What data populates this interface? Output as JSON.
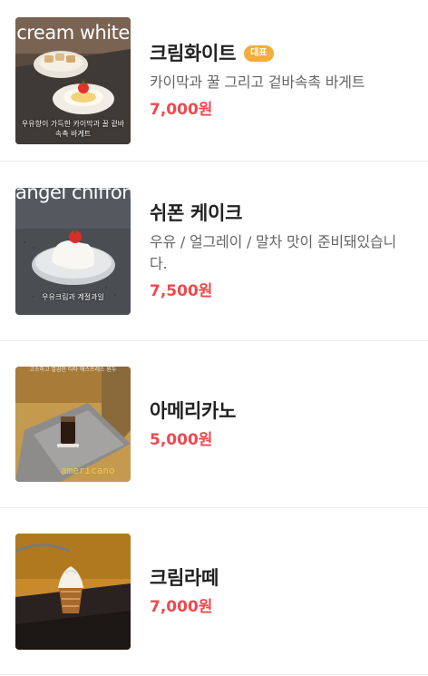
{
  "menu": {
    "items": [
      {
        "name": "크림화이트",
        "badge": "대표",
        "description": "카이막과 꿀 그리고 겉바속촉 바게트",
        "price": "7,000원",
        "image_title": "cream white",
        "image_caption": "우유향이 가득한 카이막과 꿀 겉바속촉 바게트"
      },
      {
        "name": "쉬폰 케이크",
        "description": "우유 / 얼그레이 / 말차 맛이 준비돼있습니다.",
        "price": "7,500원",
        "image_title": "angel chiffon cake",
        "image_caption": "우유크림과 계절과일"
      },
      {
        "name": "아메리카노",
        "price": "5,000원",
        "image_small_text": "고소하고 깔끔한 타타 에스프레소 원두",
        "image_title": "americano"
      },
      {
        "name": "크림라떼",
        "price": "7,000원"
      }
    ]
  },
  "colors": {
    "price": "#f0484e",
    "badge": "#f4ac3b"
  }
}
